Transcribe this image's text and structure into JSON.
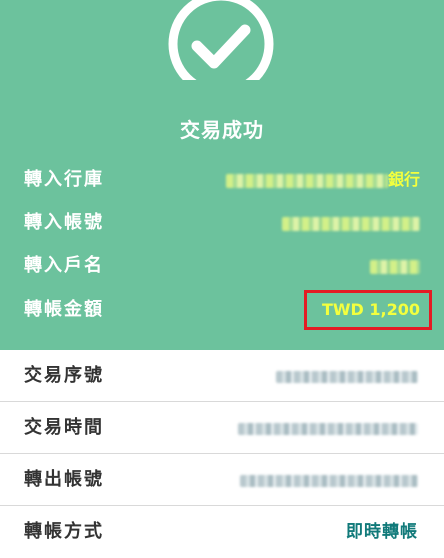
{
  "header": {
    "status_icon": "check-circle-icon",
    "title": "交易成功"
  },
  "transfer_info": {
    "bank": {
      "label": "轉入行庫",
      "value_suffix": "銀行"
    },
    "account": {
      "label": "轉入帳號"
    },
    "account_name": {
      "label": "轉入戶名"
    },
    "amount": {
      "label": "轉帳金額",
      "value": "TWD 1,200"
    }
  },
  "details": {
    "serial": {
      "label": "交易序號"
    },
    "time": {
      "label": "交易時間"
    },
    "from_account": {
      "label": "轉出帳號"
    },
    "method": {
      "label": "轉帳方式",
      "value": "即時轉帳"
    }
  },
  "colors": {
    "hero_bg": "#6cc29d",
    "highlight_text": "#f3ff3e",
    "amount_box_border": "#e51b24",
    "method_text": "#117a7a"
  }
}
